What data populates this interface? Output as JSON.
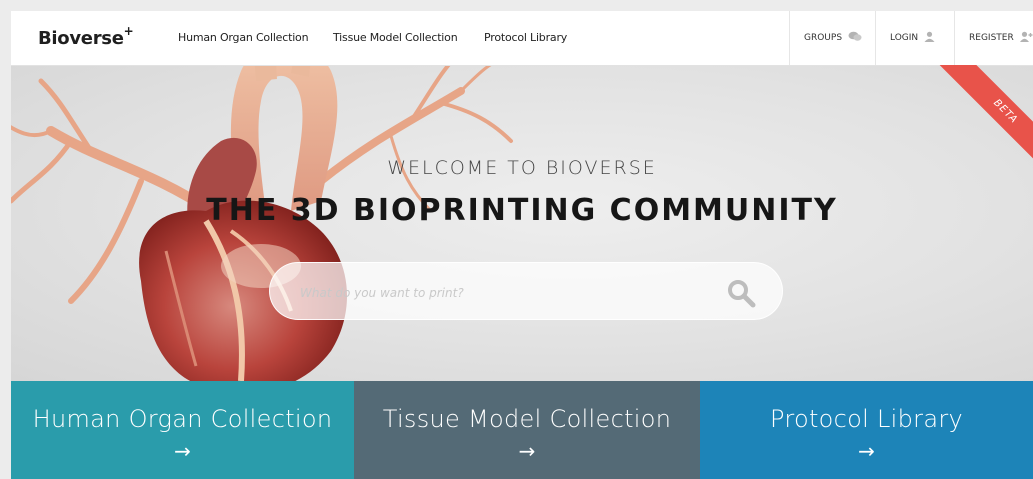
{
  "logo": {
    "text": "Bioverse",
    "sup": "+"
  },
  "nav": {
    "links": [
      "Human Organ Collection",
      "Tissue Model Collection",
      "Protocol Library"
    ],
    "groups": "GROUPS",
    "login": "LOGIN",
    "register": "REGISTER"
  },
  "ribbon": "BETA",
  "hero": {
    "welcome": "WELCOME TO BIOVERSE",
    "tagline": "THE 3D BIOPRINTING COMMUNITY",
    "search_placeholder": "What do you want to print?"
  },
  "tiles": [
    {
      "label": "Human Organ Collection",
      "arrow": "→",
      "color": "#2a9cab"
    },
    {
      "label": "Tissue Model Collection",
      "arrow": "→",
      "color": "#546a76"
    },
    {
      "label": "Protocol Library",
      "arrow": "→",
      "color": "#1d84b8"
    }
  ],
  "colors": {
    "ribbon": "#e8534a",
    "text_dark": "#161616"
  }
}
